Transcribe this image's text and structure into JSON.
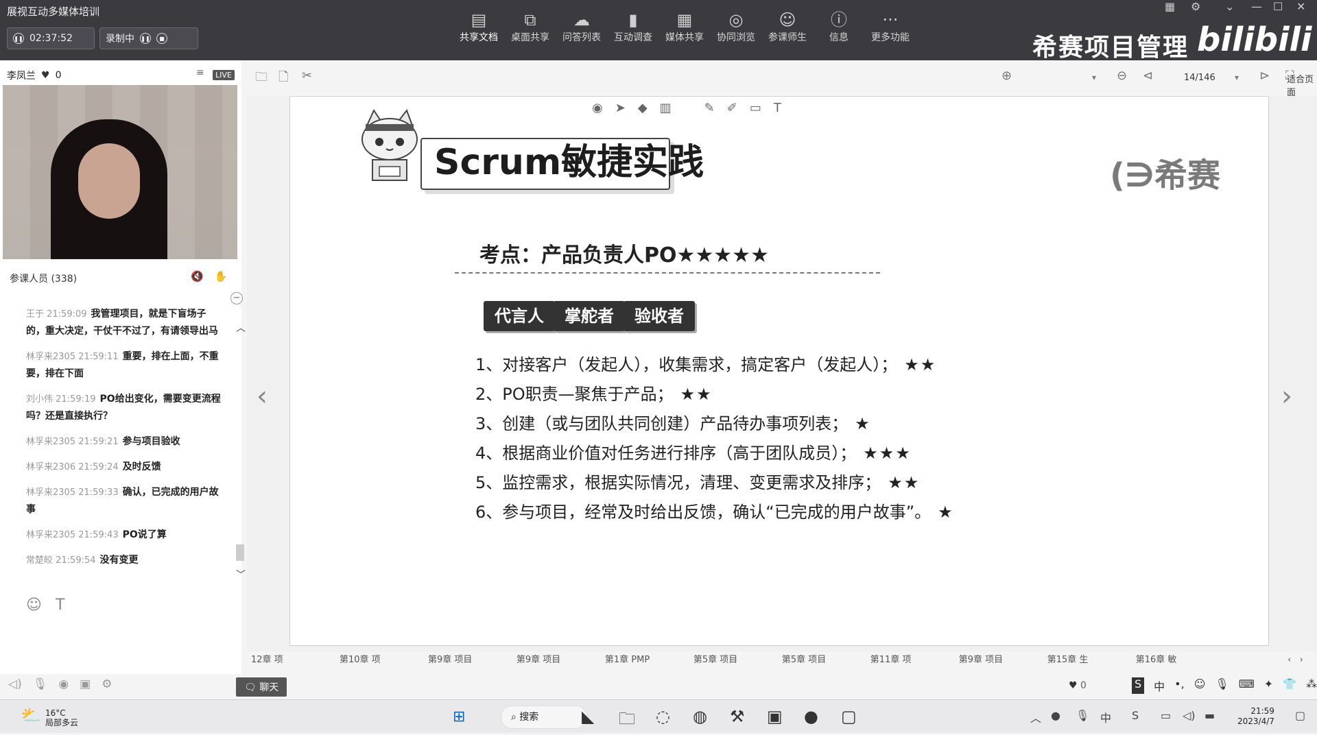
{
  "app": {
    "title": "展视互动多媒体培训",
    "timer": "02:37:52",
    "recording_label": "录制中"
  },
  "toolbar": [
    {
      "label": "共享文档",
      "icon": "document-share-icon"
    },
    {
      "label": "桌面共享",
      "icon": "desktop-share-icon"
    },
    {
      "label": "问答列表",
      "icon": "qa-icon"
    },
    {
      "label": "互动调查",
      "icon": "survey-icon"
    },
    {
      "label": "媒体共享",
      "icon": "media-icon"
    },
    {
      "label": "协同浏览",
      "icon": "browse-icon"
    },
    {
      "label": "参课师生",
      "icon": "participants-icon"
    },
    {
      "label": "信息",
      "icon": "info-icon"
    },
    {
      "label": "更多功能",
      "icon": "more-icon"
    }
  ],
  "brand": "希赛项目管理",
  "bili": "bilibili",
  "presenter": {
    "name": "李凤兰",
    "likes": "0",
    "live": "LIVE"
  },
  "participants_label": "参课人员 (338)",
  "chat": [
    {
      "meta": "王于 21:59:09",
      "text": "我管理项目，就是下盲场子的，重大决定，干仗干不过了，有请领导出马"
    },
    {
      "meta": "林孚来2305 21:59:11",
      "text": "重要，排在上面，不重要，排在下面"
    },
    {
      "meta": "刘小伟 21:59:19",
      "text": "PO给出变化，需要变更流程吗？还是直接执行？"
    },
    {
      "meta": "林孚来2305 21:59:21",
      "text": "参与项目验收"
    },
    {
      "meta": "林孚来2306 21:59:24",
      "text": "及时反馈"
    },
    {
      "meta": "林孚来2305 21:59:33",
      "text": "确认，已完成的用户故事"
    },
    {
      "meta": "林孚来2305 21:59:43",
      "text": "PO说了算"
    },
    {
      "meta": "常楚皎 21:59:54",
      "text": "没有变更"
    }
  ],
  "doc": {
    "fit": "适合页面",
    "page": "14/146"
  },
  "slide": {
    "title": "Scrum敏捷实践",
    "logo": "(∋希赛",
    "topic": "考点：产品负责人PO★★★★★",
    "roles": [
      "代言人",
      "掌舵者",
      "验收者"
    ],
    "items": [
      {
        "text": "1、对接客户（发起人），收集需求，搞定客户（发起人）；",
        "stars": "★★"
      },
      {
        "text": "2、PO职责—聚焦于产品；",
        "stars": "★★"
      },
      {
        "text": "3、创建（或与团队共同创建）产品待办事项列表；",
        "stars": "★"
      },
      {
        "text": "4、根据商业价值对任务进行排序（高于团队成员）；",
        "stars": "★★★"
      },
      {
        "text": "5、监控需求，根据实际情况，清理、变更需求及排序；",
        "stars": "★★"
      },
      {
        "text": "6、参与项目，经常及时给出反馈，确认“已完成的用户故事”。",
        "stars": "★"
      }
    ]
  },
  "chapters": [
    "12章 项",
    "第10章 项",
    "第9章 项目",
    "第9章 项目",
    "第1章 PMP",
    "第5章 项目",
    "第5章 项目",
    "第11章 项",
    "第9章 项目",
    "第15章 生",
    "第16章 敏",
    ""
  ],
  "bottom": {
    "chat_btn": "聊天",
    "likes": "0",
    "ime": "中"
  },
  "taskbar": {
    "temp": "16°C",
    "weather": "局部多云",
    "search": "搜索",
    "time": "21:59",
    "date": "2023/4/7"
  }
}
